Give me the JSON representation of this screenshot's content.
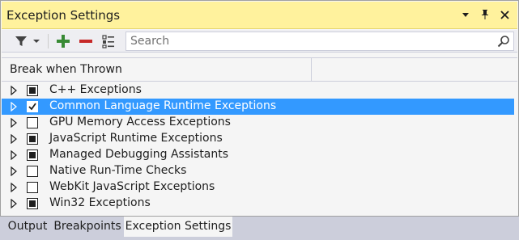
{
  "window": {
    "title": "Exception Settings"
  },
  "toolbar": {
    "search_placeholder": "Search"
  },
  "table": {
    "column_header": "Break when Thrown"
  },
  "rows": [
    {
      "label": "C++ Exceptions",
      "state": "partial",
      "selected": false
    },
    {
      "label": "Common Language Runtime Exceptions",
      "state": "checked",
      "selected": true
    },
    {
      "label": "GPU Memory Access Exceptions",
      "state": "unchecked",
      "selected": false
    },
    {
      "label": "JavaScript Runtime Exceptions",
      "state": "partial",
      "selected": false
    },
    {
      "label": "Managed Debugging Assistants",
      "state": "partial",
      "selected": false
    },
    {
      "label": "Native Run-Time Checks",
      "state": "unchecked",
      "selected": false
    },
    {
      "label": "WebKit JavaScript Exceptions",
      "state": "unchecked",
      "selected": false
    },
    {
      "label": "Win32 Exceptions",
      "state": "partial",
      "selected": false
    }
  ],
  "tabs": [
    {
      "label": "Output",
      "active": false
    },
    {
      "label": "Breakpoints",
      "active": false
    },
    {
      "label": "Exception Settings",
      "active": true
    }
  ],
  "colors": {
    "titlebar": "#fff29d",
    "selection": "#3399ff",
    "add_icon": "#388a34",
    "remove_icon": "#c62828"
  },
  "icons": [
    "filter-icon",
    "dropdown-arrow-icon",
    "add-icon",
    "remove-icon",
    "restore-defaults-icon",
    "search-icon",
    "window-position-icon",
    "pin-icon",
    "close-icon",
    "expand-triangle-icon"
  ]
}
